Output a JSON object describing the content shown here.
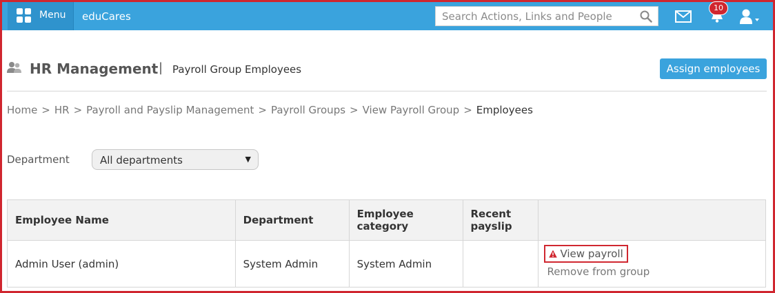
{
  "topbar": {
    "menu_label": "Menu",
    "brand": "eduCares",
    "search_placeholder": "Search Actions, Links and People",
    "notification_count": "10"
  },
  "header": {
    "title": "HR Management",
    "separator": "|",
    "subtitle": "Payroll Group Employees",
    "assign_button": "Assign employees"
  },
  "breadcrumb": {
    "items": [
      "Home",
      "HR",
      "Payroll and Payslip Management",
      "Payroll Groups",
      "View Payroll Group"
    ],
    "current": "Employees",
    "separator": ">"
  },
  "filter": {
    "label": "Department",
    "selected": "All departments"
  },
  "table": {
    "headers": [
      "Employee Name",
      "Department",
      "Employee category",
      "Recent payslip",
      ""
    ],
    "rows": [
      {
        "name": "Admin User (admin)",
        "department": "System Admin",
        "category": "System Admin",
        "recent_payslip": "",
        "action_view": "View payroll",
        "action_remove": "Remove from group"
      }
    ]
  },
  "colors": {
    "topbar": "#3aa3dd",
    "accent_button": "#3aa3dd",
    "highlight_border": "#d0262f",
    "badge": "#d0262f"
  }
}
